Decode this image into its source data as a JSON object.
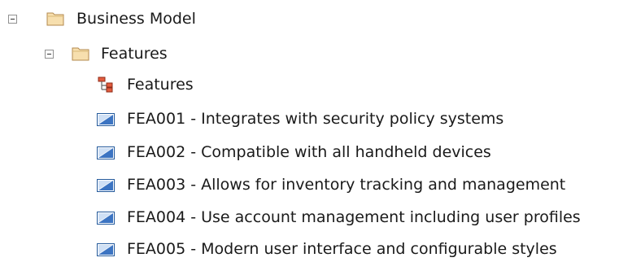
{
  "tree": {
    "root": {
      "label": "Business Model",
      "icon": "folder-icon",
      "expanded": true,
      "children": [
        {
          "label": "Features",
          "icon": "folder-icon",
          "expanded": true,
          "children": [
            {
              "label": "Features",
              "icon": "diagram-icon"
            },
            {
              "label": "FEA001 - Integrates with security policy systems",
              "icon": "feature-element-icon"
            },
            {
              "label": "FEA002 - Compatible with all handheld devices",
              "icon": "feature-element-icon"
            },
            {
              "label": "FEA003 - Allows for inventory tracking and management",
              "icon": "feature-element-icon"
            },
            {
              "label": "FEA004 - Use account management including user profiles",
              "icon": "feature-element-icon"
            },
            {
              "label": "FEA005 - Modern user interface and configurable styles",
              "icon": "feature-element-icon"
            }
          ]
        }
      ]
    }
  },
  "colors": {
    "folder_fill": "#f7dfae",
    "folder_border": "#b38a4e",
    "element_fill": "#3c74c2",
    "element_border": "#245a9c"
  }
}
